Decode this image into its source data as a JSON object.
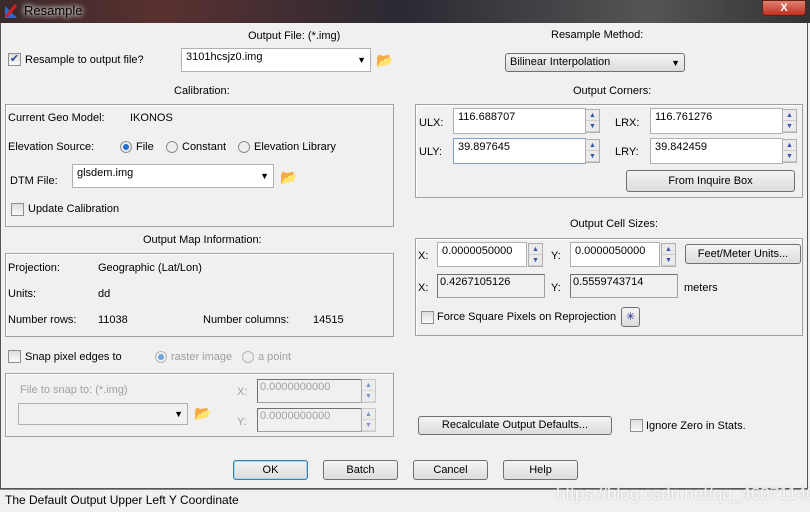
{
  "window": {
    "title": "Resample",
    "close": "X"
  },
  "output_file": {
    "label": "Output File: (*.img)",
    "value": "3101hcsjz0.img",
    "resample_checkbox": "Resample to output file?",
    "resample_checked": true
  },
  "resample_method": {
    "label": "Resample Method:",
    "value": "Bilinear Interpolation"
  },
  "calibration": {
    "label": "Calibration:",
    "geo_model_label": "Current Geo Model:",
    "geo_model": "IKONOS",
    "elevation_label": "Elevation Source:",
    "options": [
      "File",
      "Constant",
      "Elevation Library"
    ],
    "selected": "File",
    "dtm_label": "DTM File:",
    "dtm_value": "glsdem.img",
    "update_label": "Update Calibration"
  },
  "corners": {
    "label": "Output Corners:",
    "ulx_label": "ULX:",
    "ulx": "116.688707",
    "uly_label": "ULY:",
    "uly": "39.897645",
    "lrx_label": "LRX:",
    "lrx": "116.761276",
    "lry_label": "LRY:",
    "lry": "39.842459",
    "inquire_button": "From Inquire Box"
  },
  "cell_sizes": {
    "label": "Output Cell Sizes:",
    "x_label": "X:",
    "y_label": "Y:",
    "x": "0.0000050000",
    "y": "0.0000050000",
    "feet_button": "Feet/Meter Units...",
    "x_m": "0.4267105126",
    "y_m": "0.5559743714",
    "units": "meters",
    "force_square": "Force Square Pixels on Reprojection"
  },
  "map_info": {
    "label": "Output Map Information:",
    "projection_label": "Projection:",
    "projection": "Geographic (Lat/Lon)",
    "units_label": "Units:",
    "units": "dd",
    "rows_label": "Number rows:",
    "rows": "11038",
    "cols_label": "Number columns:",
    "cols": "14515"
  },
  "snap": {
    "label": "Snap pixel edges to",
    "options": [
      "raster image",
      "a point"
    ],
    "file_label": "File to snap to: (*.img)",
    "x_label": "X:",
    "y_label": "Y:",
    "x": "0.0000000000",
    "y": "0.0000000000"
  },
  "recalc_button": "Recalculate Output Defaults...",
  "ignore_zero": "Ignore Zero in Stats.",
  "buttons": {
    "ok": "OK",
    "batch": "Batch",
    "cancel": "Cancel",
    "help": "Help"
  },
  "status": "The Default Output Upper Left Y Coordinate",
  "watermark": "https://blog.csdn.net/qq_46071146"
}
